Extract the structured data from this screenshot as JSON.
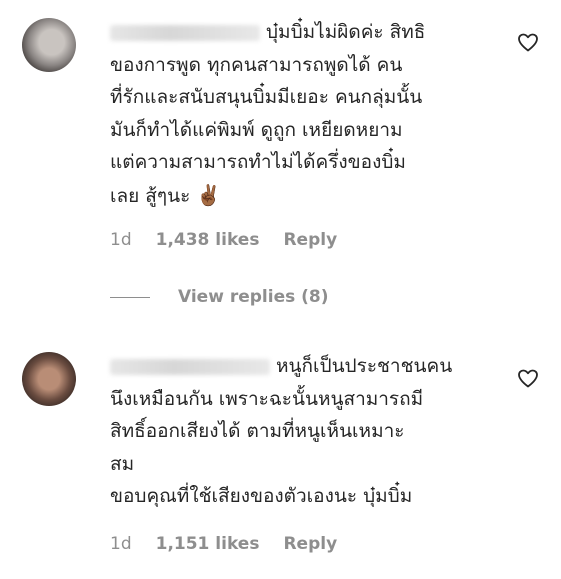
{
  "comments": [
    {
      "text": "บุ๋มบิ๋มไม่ผิดค่ะ สิทธิ\nของการพูด ทุกคนสามารถพูดได้ คน\nที่รักและสนับสนุนบิ๋มมีเยอะ คนกลุ่มนั้น\nมันก็ทำได้แค่พิมพ์ ดูถูก เหยียดหยาม\nแต่ความสามารถทำไม่ได้ครึ่งของบิ๋ม\nเลย สู้ๆนะ",
      "emoji": "✌🏾",
      "time": "1d",
      "likes": "1,438 likes",
      "reply": "Reply"
    },
    {
      "text": "หนูก็เป็นประชาชนคน\nนึงเหมือนกัน เพราะฉะนั้นหนูสามารถมี\nสิทธิ์ออกเสียงได้ ตามที่หนูเห็นเหมาะ\nสม\nขอบคุณที่ใช้เสียงของตัวเองนะ บุ๋มบิ๋ม",
      "time": "1d",
      "likes": "1,151 likes",
      "reply": "Reply"
    }
  ],
  "view_replies": "View replies (8)",
  "icons": {
    "like": "heart-outline-icon"
  }
}
